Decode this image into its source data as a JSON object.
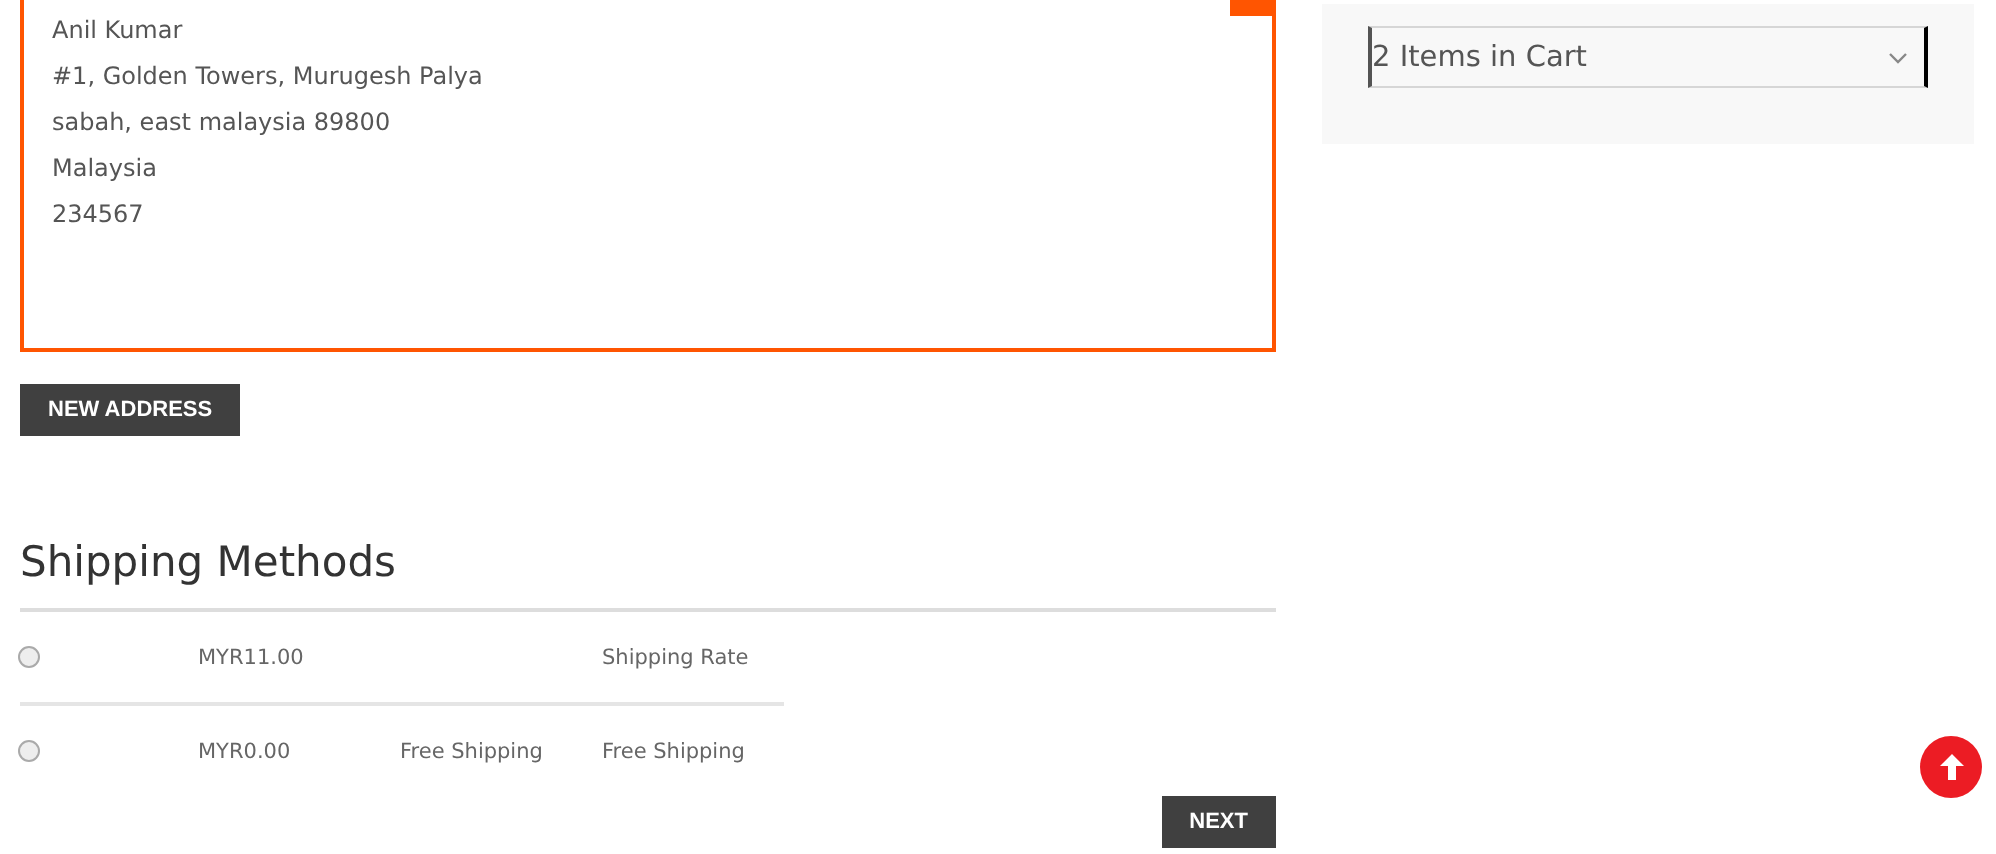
{
  "address_card": {
    "selected": true,
    "lines": [
      "Anil Kumar",
      "#1, Golden Towers, Murugesh Palya",
      "sabah, east malaysia 89800",
      "Malaysia",
      "234567"
    ]
  },
  "new_address_button": "NEW ADDRESS",
  "shipping_methods": {
    "title": "Shipping Methods",
    "rows": [
      {
        "selected": false,
        "price": "MYR11.00",
        "carrier": "",
        "method": "Shipping Rate"
      },
      {
        "selected": false,
        "price": "MYR0.00",
        "carrier": "Free Shipping",
        "method": "Free Shipping"
      }
    ]
  },
  "next_button": "NEXT",
  "cart_summary": {
    "label": "2 Items in Cart",
    "expanded": false
  }
}
